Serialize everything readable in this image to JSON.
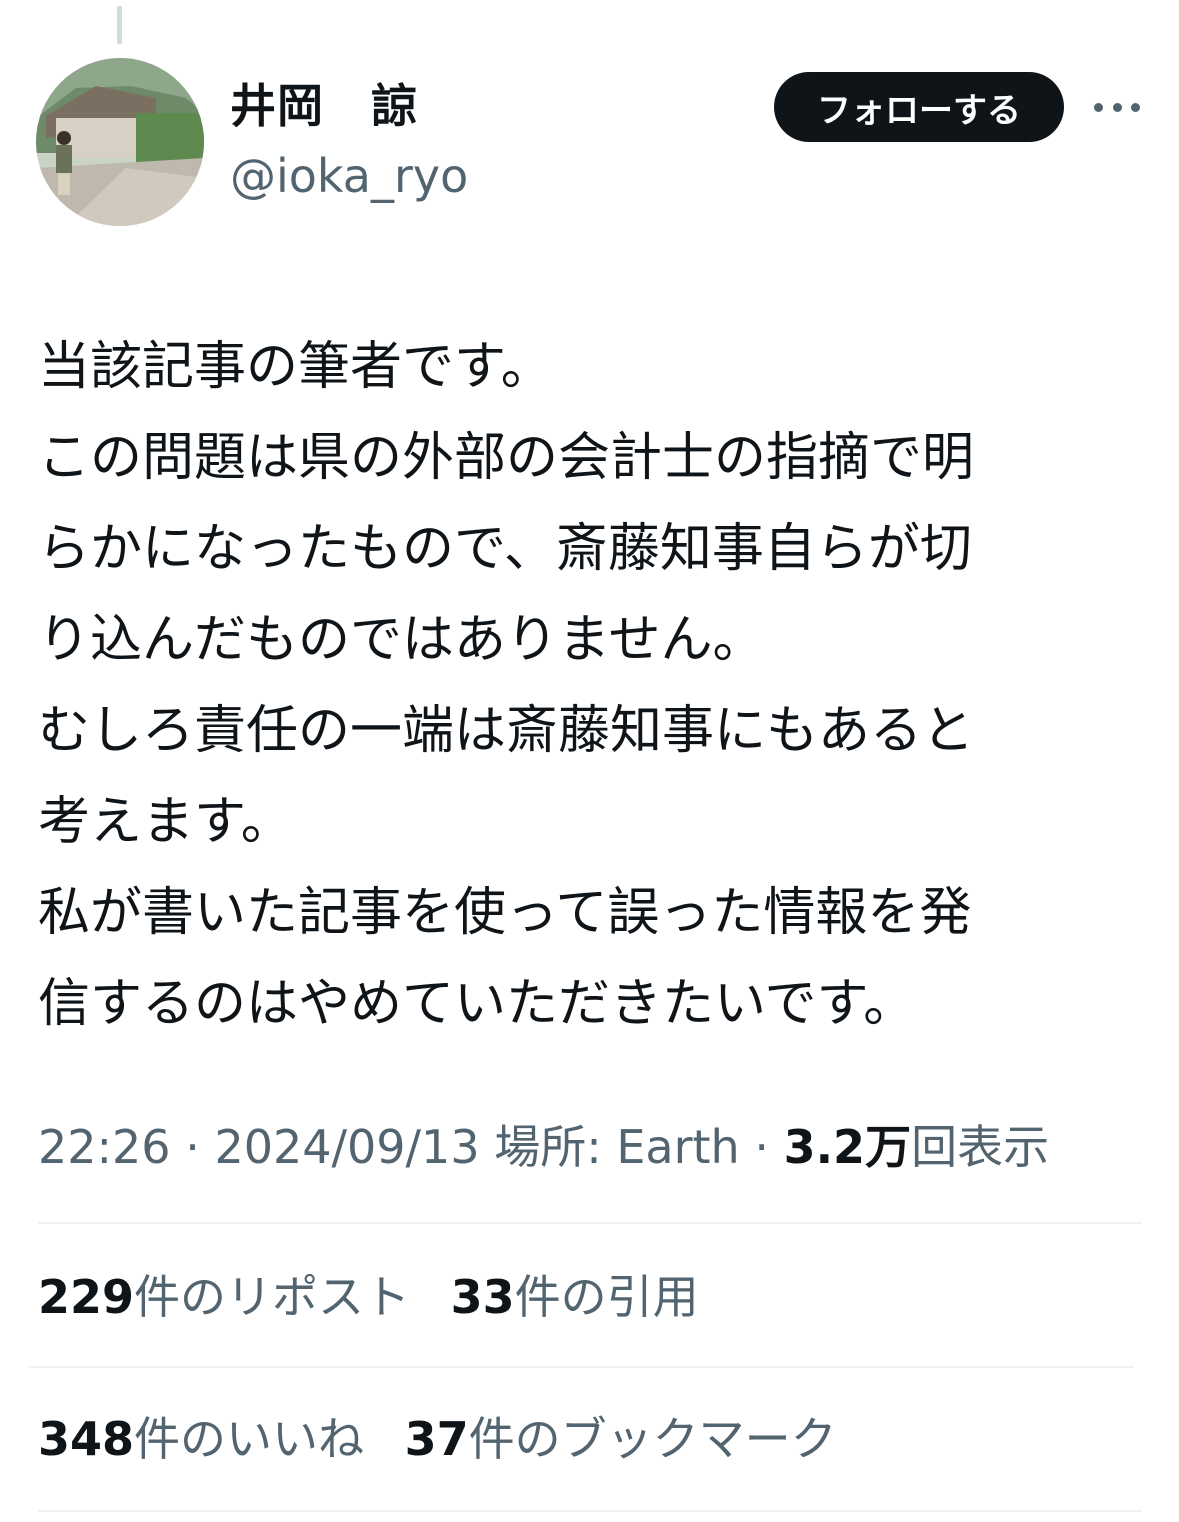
{
  "author": {
    "display_name": "井岡　諒",
    "handle": "@ioka_ryo"
  },
  "actions": {
    "follow_label": "フォローする",
    "more_icon": "more-horizontal-icon"
  },
  "tweet": {
    "lines": [
      "当該記事の筆者です。",
      "この問題は県の外部の会計士の指摘で明",
      "らかになったもので、斎藤知事自らが切",
      "り込んだものではありません。",
      "むしろ責任の一端は斎藤知事にもあると",
      "考えます。",
      "私が書いた記事を使って誤った情報を発",
      "信するのはやめていただきたいです。"
    ]
  },
  "meta": {
    "time": "22:26",
    "sep": "·",
    "date": "2024/09/13",
    "location_label": "場所: Earth",
    "views_count": "3.2万",
    "views_label": "回表示"
  },
  "stats": {
    "reposts": {
      "count": "229",
      "label": "件のリポスト"
    },
    "quotes": {
      "count": "33",
      "label": "件の引用"
    },
    "likes": {
      "count": "348",
      "label": "件のいいね"
    },
    "bookmarks": {
      "count": "37",
      "label": "件のブックマーク"
    }
  },
  "colors": {
    "text_primary": "#0f1419",
    "text_secondary": "#536471",
    "divider": "#eff3f4",
    "button_bg": "#0f1419"
  }
}
